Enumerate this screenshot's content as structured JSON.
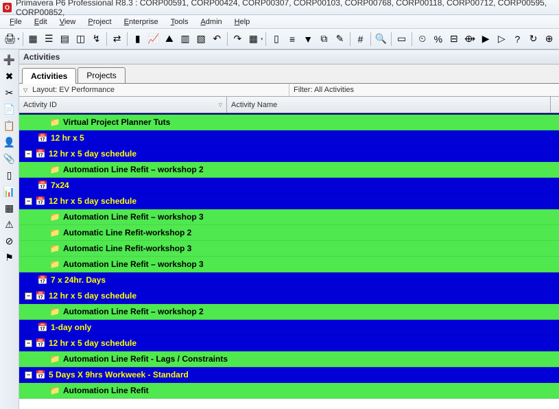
{
  "title": "Primavera P6 Professional R8.3 : CORP00591, CORP00424, CORP00307, CORP00103, CORP00768, CORP00118, CORP00712, CORP00595, CORP00852,",
  "menu": [
    "File",
    "Edit",
    "View",
    "Project",
    "Enterprise",
    "Tools",
    "Admin",
    "Help"
  ],
  "section_header": "Activities",
  "tabs": [
    {
      "label": "Activities",
      "active": true
    },
    {
      "label": "Projects",
      "active": false
    }
  ],
  "layout_label": "Layout: EV Performance",
  "filter_label": "Filter: All Activities",
  "columns": {
    "activity_id": "Activity ID",
    "activity_name": "Activity Name"
  },
  "rows": [
    {
      "type": "green",
      "indent": 2,
      "expand": null,
      "icon": "folder-grey",
      "text": "Virtual Project Planner Tuts"
    },
    {
      "type": "blue",
      "indent": 1,
      "expand": null,
      "icon": "calendar",
      "text": "12 hr x 5"
    },
    {
      "type": "blue",
      "indent": 0,
      "expand": "minus",
      "icon": "calendar",
      "text": "12 hr x 5 day schedule"
    },
    {
      "type": "green",
      "indent": 2,
      "expand": null,
      "icon": "folder-grey",
      "text": "Automation Line Refit – workshop 2"
    },
    {
      "type": "blue",
      "indent": 1,
      "expand": null,
      "icon": "calendar",
      "text": "7x24"
    },
    {
      "type": "blue",
      "indent": 0,
      "expand": "minus",
      "icon": "calendar",
      "text": "12 hr x 5 day schedule"
    },
    {
      "type": "green",
      "indent": 2,
      "expand": null,
      "icon": "folder-grey",
      "text": "Automation Line Refit – workshop 3"
    },
    {
      "type": "green",
      "indent": 2,
      "expand": null,
      "icon": "folder-grey",
      "text": "Automatic Line Refit-workshop 2"
    },
    {
      "type": "green",
      "indent": 2,
      "expand": null,
      "icon": "folder-grey",
      "text": "Automatic Line Refit-workshop 3"
    },
    {
      "type": "green",
      "indent": 2,
      "expand": null,
      "icon": "folder-grey",
      "text": "Automation Line Refit – workshop 3"
    },
    {
      "type": "blue",
      "indent": 1,
      "expand": null,
      "icon": "calendar",
      "text": "7 x 24hr. Days"
    },
    {
      "type": "blue",
      "indent": 0,
      "expand": "minus",
      "icon": "calendar",
      "text": "12 hr x 5 day schedule"
    },
    {
      "type": "green",
      "indent": 2,
      "expand": null,
      "icon": "folder-grey",
      "text": "Automation Line Refit – workshop 2"
    },
    {
      "type": "blue",
      "indent": 1,
      "expand": null,
      "icon": "calendar",
      "text": "1-day only"
    },
    {
      "type": "blue",
      "indent": 0,
      "expand": "minus",
      "icon": "calendar",
      "text": "12 hr x 5 day schedule"
    },
    {
      "type": "green",
      "indent": 2,
      "expand": null,
      "icon": "folder-grey",
      "text": "Automation Line Refit - Lags / Constraints"
    },
    {
      "type": "blue",
      "indent": 0,
      "expand": "minus",
      "icon": "calendar",
      "text": "5 Days X 9hrs Workweek - Standard"
    },
    {
      "type": "green",
      "indent": 2,
      "expand": null,
      "icon": "folder-grey",
      "text": "Automation Line Refit"
    }
  ],
  "toolbar_icons": [
    "print",
    "view-grid",
    "view-list",
    "view-gantt",
    "view-network",
    "view-trace",
    "view-leveling",
    "chart-bar",
    "chart-line",
    "chart-area",
    "chart-stack",
    "chart-stack2",
    "undo",
    "redo",
    "table",
    "columns",
    "rows",
    "filter",
    "group",
    "wizard",
    "hash",
    "find",
    "report",
    "schedule",
    "percent",
    "baseline",
    "timescale",
    "progress",
    "progress2",
    "help",
    "refresh",
    "plus"
  ],
  "side_icons": [
    "add",
    "delete",
    "cut",
    "copy",
    "paste",
    "resources",
    "assign",
    "column",
    "chart",
    "wbs",
    "error",
    "circle",
    "flag"
  ]
}
